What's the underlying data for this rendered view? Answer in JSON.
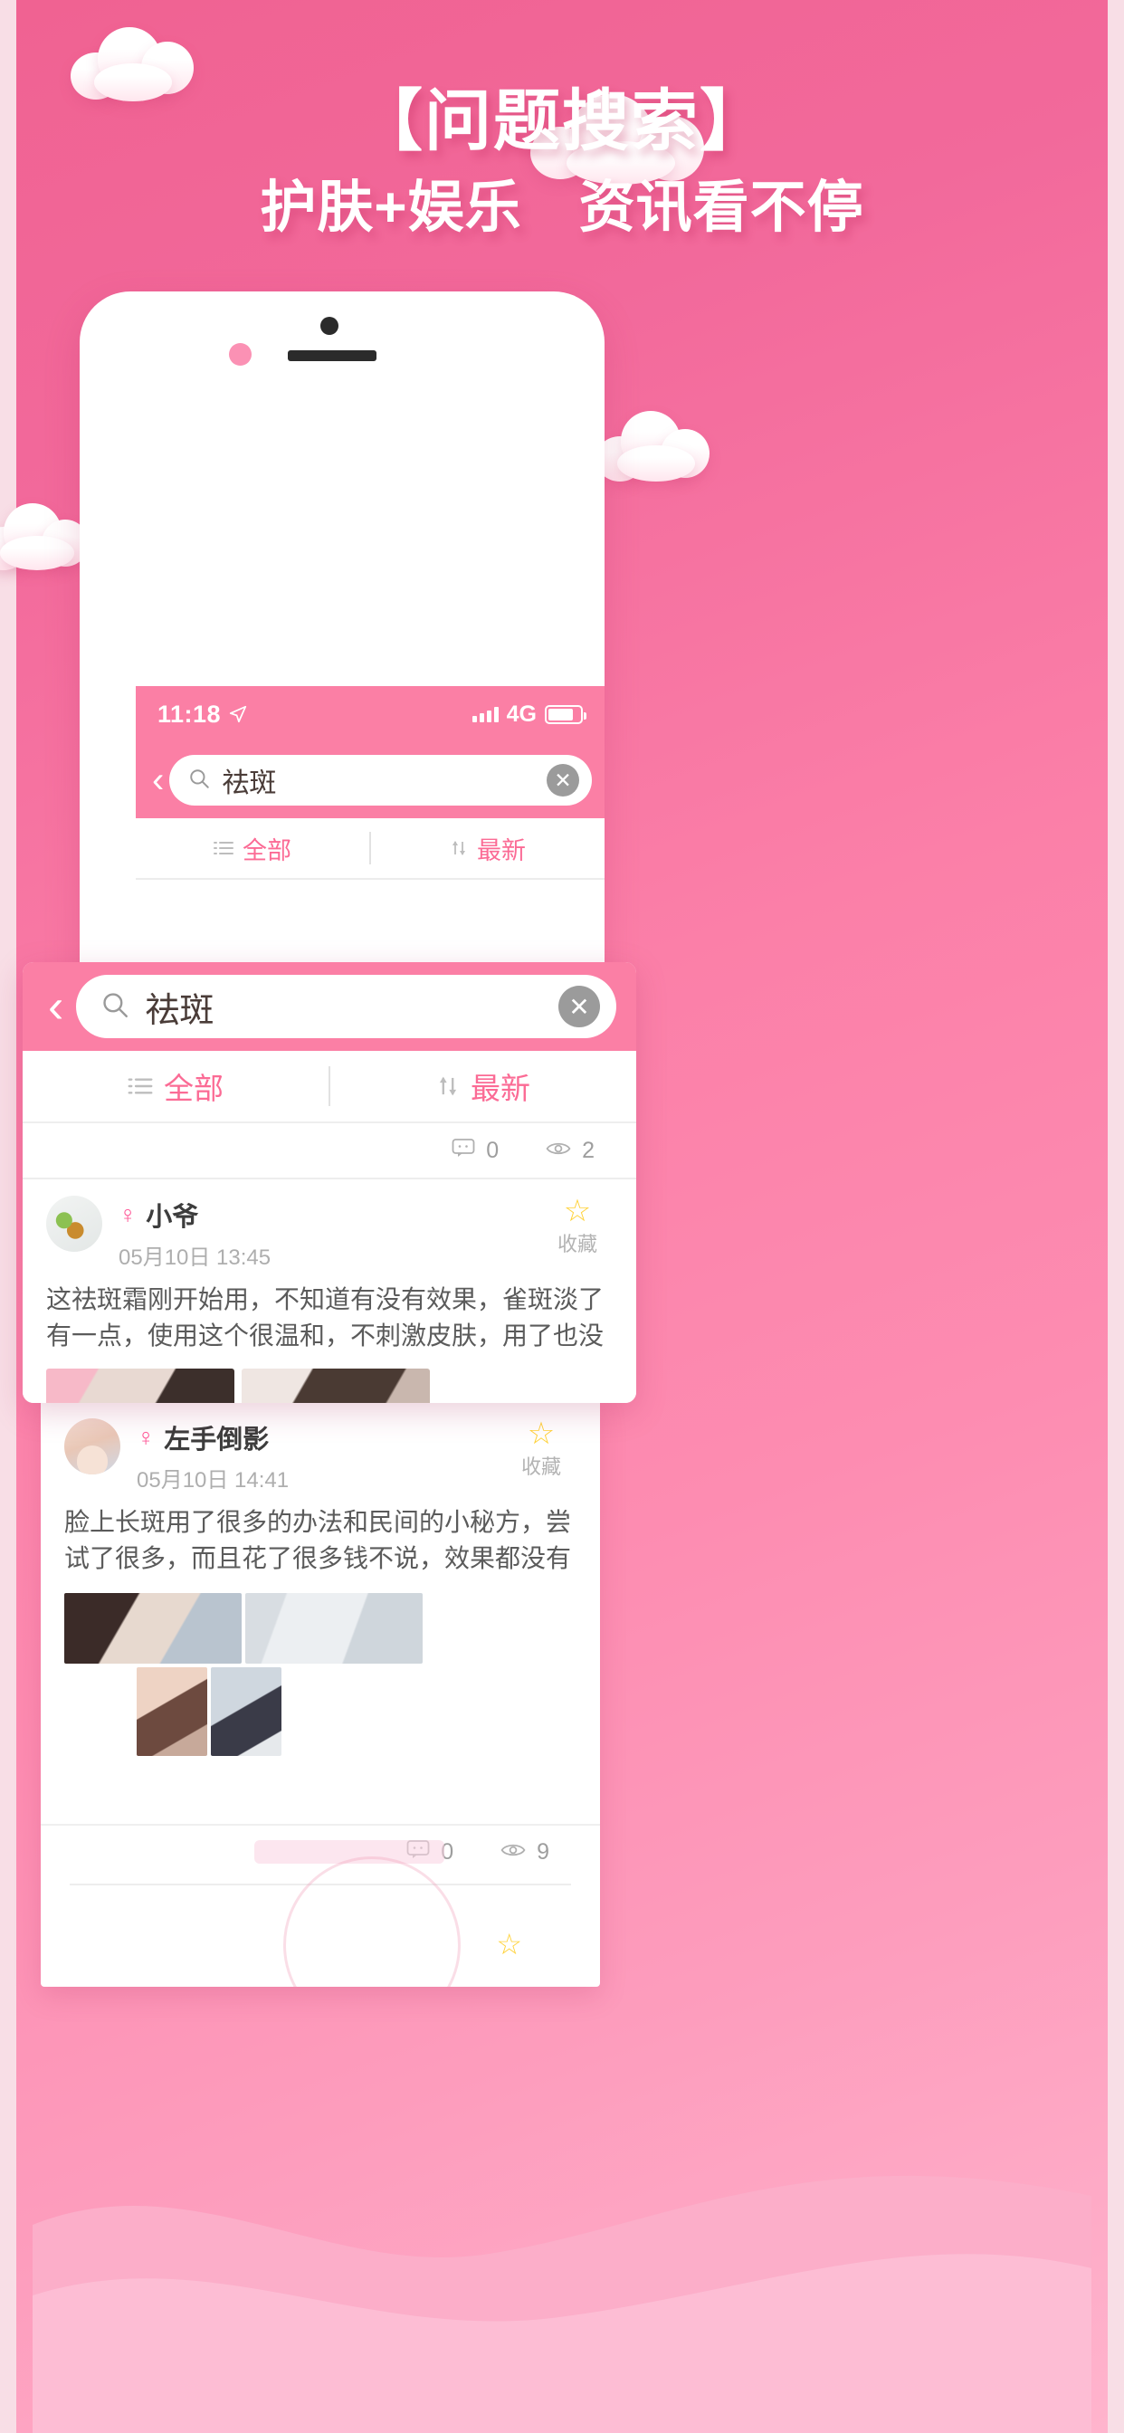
{
  "banner": {
    "title": "【问题搜索】",
    "subtitle": "护肤+娱乐　资讯看不停",
    "accent_pink": "#fb7fa5",
    "deep_pink": "#f0628f",
    "highlight_pink": "#ff5c9a"
  },
  "phone": {
    "status_bar": {
      "time": "11:18",
      "location_icon": "location-arrow-icon",
      "signal_icon": "signal-bars-icon",
      "network": "4G",
      "battery_icon": "battery-icon"
    },
    "search": {
      "back_icon": "chevron-left-icon",
      "search_icon": "search-icon",
      "value": "祛斑",
      "placeholder": "祛斑",
      "clear_icon": "clear-circle-icon",
      "clear_label": "✕"
    },
    "tabs": [
      {
        "label": "全部",
        "icon": "list-icon"
      },
      {
        "label": "最新",
        "icon": "sort-icon"
      }
    ]
  },
  "card": {
    "search": {
      "back_icon": "chevron-left-icon",
      "search_icon": "search-icon",
      "value": "祛斑",
      "placeholder": "祛斑",
      "clear_icon": "clear-circle-icon",
      "clear_label": "✕"
    },
    "tabs": [
      {
        "label": "全部",
        "icon": "list-icon"
      },
      {
        "label": "最新",
        "icon": "sort-icon"
      }
    ],
    "top_stats": {
      "comment_icon": "comment-icon",
      "comment_count": "0",
      "view_icon": "eye-icon",
      "view_count": "2"
    }
  },
  "posts": [
    {
      "avatar": "leaf-avatar",
      "gender_icon": "female-symbol",
      "username": "小爷",
      "date": "05月10日 13:45",
      "favorite": {
        "icon": "star-icon",
        "label": "收藏"
      },
      "text": "这祛斑霜刚开始用，不知道有没有效果，雀斑淡了有一点，使用这个很温和，不刺激皮肤，用了也没有出现过敏，皮肤比以前光滑…",
      "images": 2
    },
    {
      "avatar": "portrait-avatar",
      "gender_icon": "female-symbol",
      "username": "左手倒影",
      "date": "05月10日 14:41",
      "favorite": {
        "icon": "star-icon",
        "label": "收藏"
      },
      "text": "脸上长斑用了很多的办法和民间的小秘方，尝试了很多，而且花了很多钱不说，效果都没有太大变化，天天用很厚的粉底，真的难…",
      "images": 4,
      "stats": {
        "comment_icon": "comment-icon",
        "comment_count": "0",
        "view_icon": "eye-icon",
        "view_count": "9"
      }
    }
  ]
}
